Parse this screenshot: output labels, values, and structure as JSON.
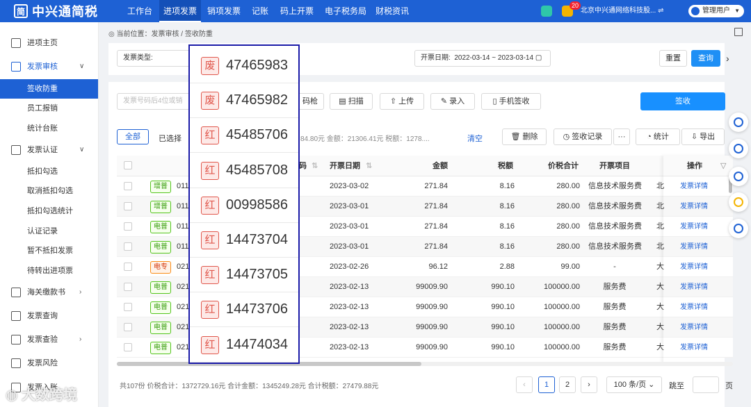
{
  "app": {
    "logo_glyph": "简",
    "name": "中兴通简税"
  },
  "nav": [
    "工作台",
    "进项发票",
    "销项发票",
    "记账",
    "码上开票",
    "电子税务局",
    "财税资讯"
  ],
  "top": {
    "badge": "20",
    "company": "北京中兴通网络科技股...",
    "swap": "⇌",
    "user": "管理用户"
  },
  "sidebar": {
    "home": "进项主页",
    "invoice_review": "发票审核",
    "sign_defense": "签收防重",
    "staff_reimburse": "员工报销",
    "stat_ledger": "统计台账",
    "invoice_cert": "发票认证",
    "deduct_check": "抵扣勾选",
    "cancel_deduct": "取消抵扣勾选",
    "deduct_stats": "抵扣勾选统计",
    "cert_record": "认证记录",
    "no_deduct": "暂不抵扣发票",
    "pending_transfer": "待转出进项票",
    "customs": "海关缴款书",
    "invoice_query": "发票查询",
    "invoice_check": "发票查验",
    "invoice_risk": "发票风险",
    "invoice_in": "发票入账"
  },
  "breadcrumb": "当前位置：发票审核 / 签收防重",
  "filters": {
    "type_label": "发票类型:",
    "date_label": "开票日期:",
    "date_range": "2022-03-14 ~ 2023-03-14",
    "reset": "重置",
    "query": "查询"
  },
  "toolbar": {
    "search_placeholder": "发票号码后4位或销",
    "scan_code": "码枪",
    "scan": "扫描",
    "upload": "上传",
    "entry": "录入",
    "mobile_sign": "手机签收",
    "sign": "签收"
  },
  "selection": {
    "all_tab": "全部",
    "selected": "已选择",
    "summary": "84.80元 金额：21306.41元 税额：1278....",
    "clear": "清空",
    "delete": "删除",
    "sign_record": "签收记录",
    "more": "···",
    "stats": "统计",
    "export": "导出"
  },
  "table": {
    "headers": {
      "no_tail": "码",
      "date": "开票日期",
      "amount": "金额",
      "tax": "税额",
      "total": "价税合计",
      "item": "开票项目",
      "op": "操作"
    },
    "rows": [
      {
        "tag": "增普",
        "no": "011",
        "date": "2023-03-02",
        "amount": "271.84",
        "tax": "8.16",
        "total": "280.00",
        "item": "信息技术服务费",
        "seller": "北",
        "op": "发票详情"
      },
      {
        "tag": "增普",
        "no": "011",
        "date": "2023-03-01",
        "amount": "271.84",
        "tax": "8.16",
        "total": "280.00",
        "item": "信息技术服务费",
        "seller": "北",
        "op": "发票详情"
      },
      {
        "tag": "电普",
        "no": "011",
        "date": "2023-03-01",
        "amount": "271.84",
        "tax": "8.16",
        "total": "280.00",
        "item": "信息技术服务费",
        "seller": "北",
        "op": "发票详情"
      },
      {
        "tag": "电普",
        "no": "011",
        "date": "2023-03-01",
        "amount": "271.84",
        "tax": "8.16",
        "total": "280.00",
        "item": "信息技术服务费",
        "seller": "北",
        "op": "发票详情"
      },
      {
        "tag": "电专",
        "no": "021",
        "date": "2023-02-26",
        "amount": "96.12",
        "tax": "2.88",
        "total": "99.00",
        "item": "-",
        "seller": "大",
        "op": "发票详情"
      },
      {
        "tag": "电普",
        "no": "021",
        "date": "2023-02-13",
        "amount": "99009.90",
        "tax": "990.10",
        "total": "100000.00",
        "item": "服务费",
        "seller": "大",
        "op": "发票详情"
      },
      {
        "tag": "电普",
        "no": "021",
        "date": "2023-02-13",
        "amount": "99009.90",
        "tax": "990.10",
        "total": "100000.00",
        "item": "服务费",
        "seller": "大",
        "op": "发票详情"
      },
      {
        "tag": "电普",
        "no": "021",
        "date": "2023-02-13",
        "amount": "99009.90",
        "tax": "990.10",
        "total": "100000.00",
        "item": "服务费",
        "seller": "大",
        "op": "发票详情"
      },
      {
        "tag": "电普",
        "no": "021",
        "date": "2023-02-13",
        "amount": "99009.90",
        "tax": "990.10",
        "total": "100000.00",
        "item": "服务费",
        "seller": "大",
        "op": "发票详情"
      }
    ]
  },
  "overlay": [
    {
      "tag": "废",
      "num": "47465983"
    },
    {
      "tag": "废",
      "num": "47465982"
    },
    {
      "tag": "红",
      "num": "45485706"
    },
    {
      "tag": "红",
      "num": "45485708"
    },
    {
      "tag": "红",
      "num": "00998586"
    },
    {
      "tag": "红",
      "num": "14473704"
    },
    {
      "tag": "红",
      "num": "14473705"
    },
    {
      "tag": "红",
      "num": "14473706"
    },
    {
      "tag": "红",
      "num": "14474034"
    }
  ],
  "footer": {
    "summary": "共107份 价税合计：1372729.16元 合计金额：1345249.28元 合计税额：27479.88元",
    "prev": "‹",
    "page1": "1",
    "page2": "2",
    "next": "›",
    "page_size": "100 条/页",
    "goto": "跳至",
    "page_unit": "页"
  },
  "watermark": "大数跨境"
}
